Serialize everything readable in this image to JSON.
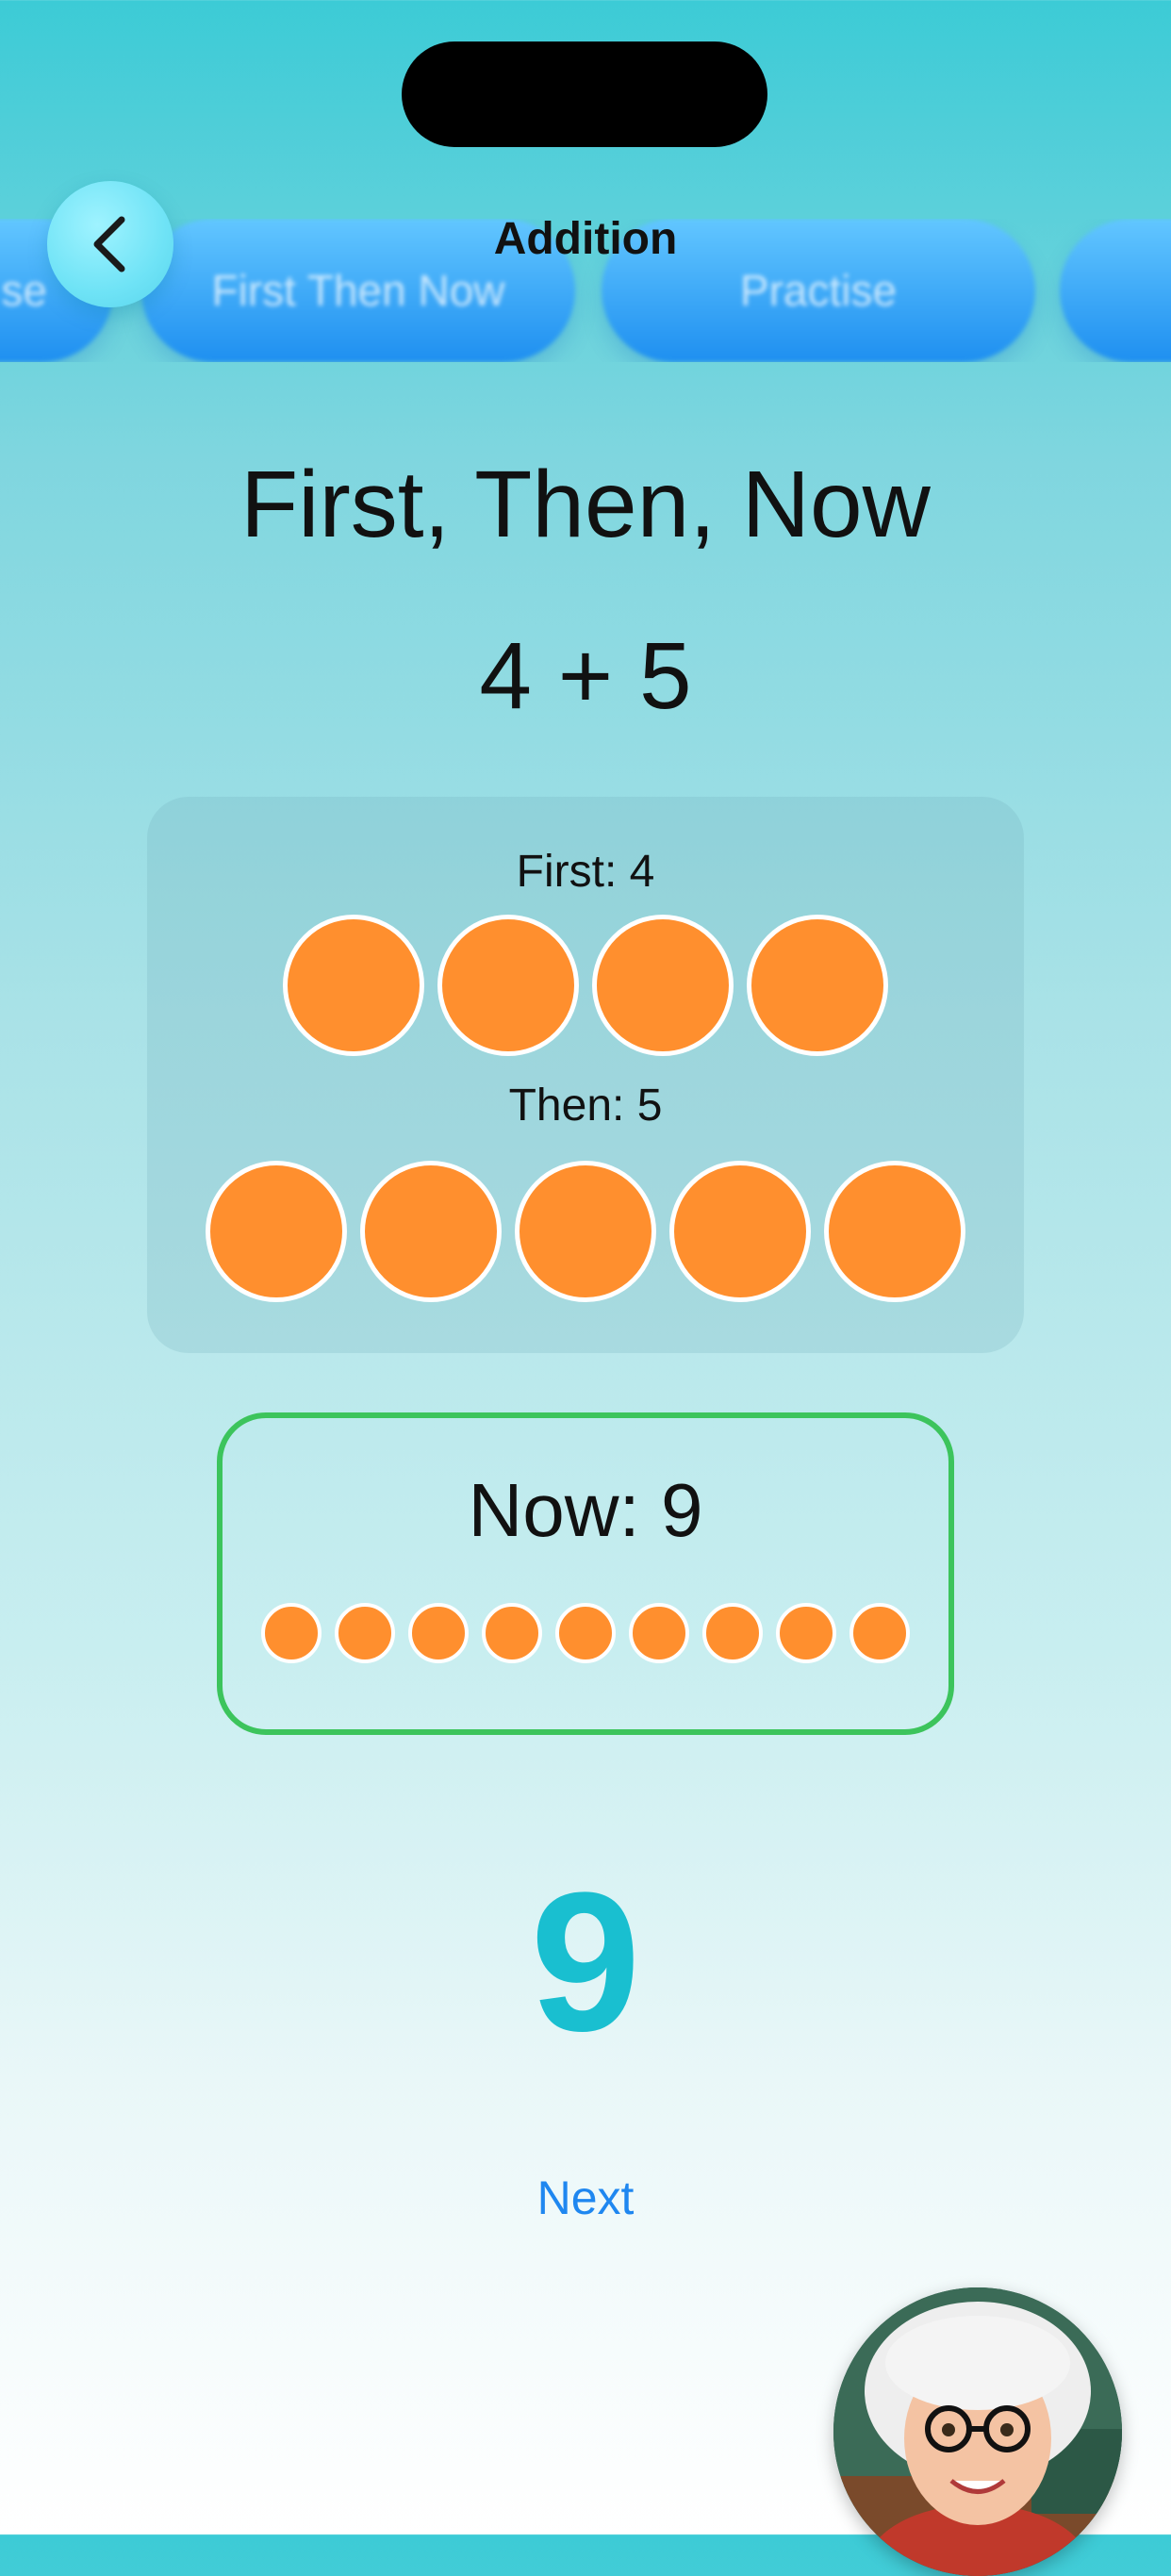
{
  "nav": {
    "title": "Addition",
    "back_icon": "chevron-left-icon"
  },
  "tabs": [
    {
      "label": "se"
    },
    {
      "label": "First Then Now"
    },
    {
      "label": "Practise"
    },
    {
      "label": ""
    }
  ],
  "lesson": {
    "title": "First, Then, Now",
    "equation": "4 + 5"
  },
  "groups": {
    "first": {
      "label": "First: 4",
      "count": 4
    },
    "then": {
      "label": "Then: 5",
      "count": 5
    }
  },
  "now": {
    "label": "Now: 9",
    "count": 9
  },
  "answer": "9",
  "next_label": "Next",
  "colors": {
    "dot": "#ff8f2e",
    "answer": "#19bfd0",
    "now_border": "#3cc45c",
    "link": "#1f87f0",
    "tab": "#1e8ff0"
  }
}
